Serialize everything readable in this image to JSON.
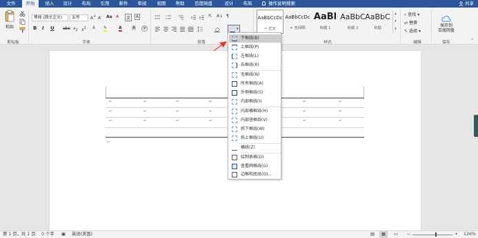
{
  "tabs": [
    "文件",
    "开始",
    "插入",
    "设计",
    "布局",
    "引用",
    "邮件",
    "审阅",
    "视图",
    "帮助",
    "百度网盘",
    "设计",
    "布局",
    "操作说明搜索"
  ],
  "share_label": "共享",
  "clipboard": {
    "paste_label": "粘贴",
    "group_label": "剪贴板"
  },
  "font": {
    "font_name": "等线 (西文正文)",
    "font_size": "五号",
    "group_label": "字体",
    "bold": "B",
    "italic": "I",
    "underline": "U"
  },
  "paragraph": {
    "group_label": "段落"
  },
  "styles": {
    "group_label": "样式",
    "cards": [
      {
        "sample": "AaBbCcDc",
        "name": "↵ 正文"
      },
      {
        "sample": "AaBbCcDc",
        "name": "↵ 无间隔"
      },
      {
        "sample": "AaBl",
        "name": "标题 1"
      },
      {
        "sample": "AaBbC",
        "name": "标题 2"
      },
      {
        "sample": "AaBbC",
        "name": "标题"
      }
    ]
  },
  "editing": {
    "find": "查找",
    "replace": "替换",
    "select": "选择",
    "group_label": "编辑"
  },
  "save_group": {
    "button_label": "保存到\n百度网盘",
    "group_label": "保存"
  },
  "border_menu": {
    "items": [
      "下框线(B)",
      "上框线(P)",
      "左框线(L)",
      "右框线(R)",
      "无框线(N)",
      "所有框线(A)",
      "外侧框线(S)",
      "内部框线(I)",
      "内部横框线(H)",
      "内部竖框线(V)",
      "斜下框线(W)",
      "斜上框线(U)",
      "横线(Z)",
      "绘制表格(D)",
      "查看网格线(G)",
      "边框和底纹(O)..."
    ]
  },
  "table": {
    "rows": 3,
    "cols": 7,
    "cell_mark": "↵"
  },
  "status": {
    "page": "第 1 页，共 1 页",
    "words": "0 个字",
    "language": "英语(美国)",
    "zoom": "126%"
  }
}
